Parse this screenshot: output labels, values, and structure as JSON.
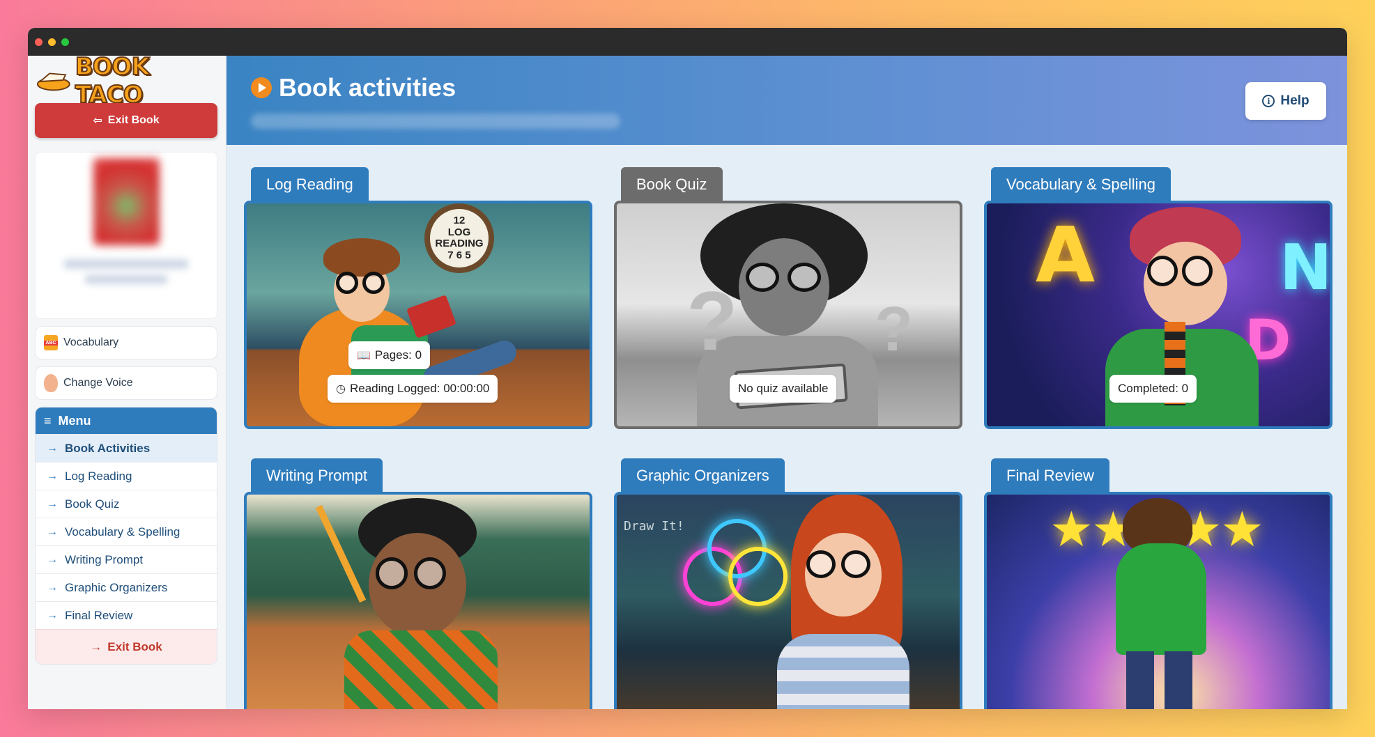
{
  "window": {
    "controls": [
      "close",
      "minimize",
      "maximize"
    ]
  },
  "sidebar": {
    "logo_text": "BOOK TACO",
    "exit_top_label": "Exit Book",
    "vocabulary_label": "Vocabulary",
    "change_voice_label": "Change Voice",
    "menu_title": "Menu",
    "menu_items": [
      {
        "label": "Book Activities",
        "active": true
      },
      {
        "label": "Log Reading",
        "active": false
      },
      {
        "label": "Book Quiz",
        "active": false
      },
      {
        "label": "Vocabulary & Spelling",
        "active": false
      },
      {
        "label": "Writing Prompt",
        "active": false
      },
      {
        "label": "Graphic Organizers",
        "active": false
      },
      {
        "label": "Final Review",
        "active": false
      }
    ],
    "menu_exit_label": "Exit Book"
  },
  "header": {
    "title": "Book activities",
    "help_label": "Help"
  },
  "cards": [
    {
      "tab": "Log Reading",
      "badges": [
        "Pages: 0",
        "Reading Logged: 00:00:00"
      ],
      "clock_top": "12",
      "clock_word1": "LOG",
      "clock_word2": "READING",
      "clock_bottom": "7 6 5"
    },
    {
      "tab": "Book Quiz",
      "badges": [
        "No quiz available"
      ]
    },
    {
      "tab": "Vocabulary & Spelling",
      "badges": [
        "Completed: 0"
      ],
      "letters": [
        "A",
        "N",
        "D"
      ]
    },
    {
      "tab": "Writing Prompt",
      "badges": []
    },
    {
      "tab": "Graphic Organizers",
      "badges": [],
      "chalk_text": "Draw It!"
    },
    {
      "tab": "Final Review",
      "badges": []
    }
  ],
  "colors": {
    "primary": "#2f7cbd",
    "exit_red": "#cf3a3a",
    "disabled_gray": "#6c6c6c",
    "accent_orange": "#f28b1e"
  }
}
